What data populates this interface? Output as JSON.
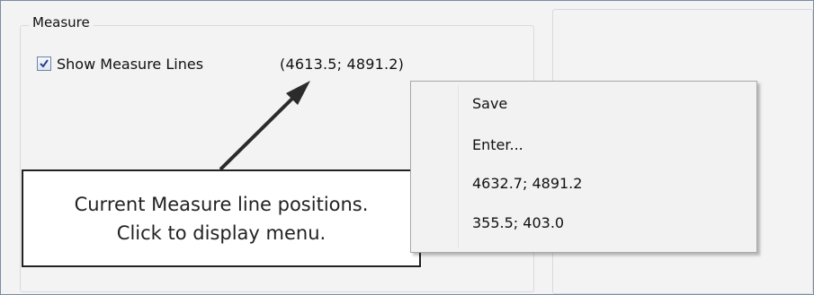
{
  "measure_group": {
    "title": "Measure",
    "show_lines_checked": true,
    "show_lines_label": "Show Measure Lines",
    "coordinates": "(4613.5; 4891.2)"
  },
  "callout": {
    "line1": "Current Measure line positions.",
    "line2": "Click to display menu."
  },
  "context_menu": {
    "items": [
      {
        "label": "Save"
      },
      {
        "label": "Enter..."
      },
      {
        "label": "4632.7;  4891.2"
      },
      {
        "label": "355.5;  403.0"
      }
    ]
  },
  "colors": {
    "frame_border": "#7a8ca3",
    "menu_background": "#f2f2f2",
    "callout_border": "#222222"
  },
  "icons": {
    "checkbox": "check-icon",
    "pointer": "arrow-icon"
  }
}
